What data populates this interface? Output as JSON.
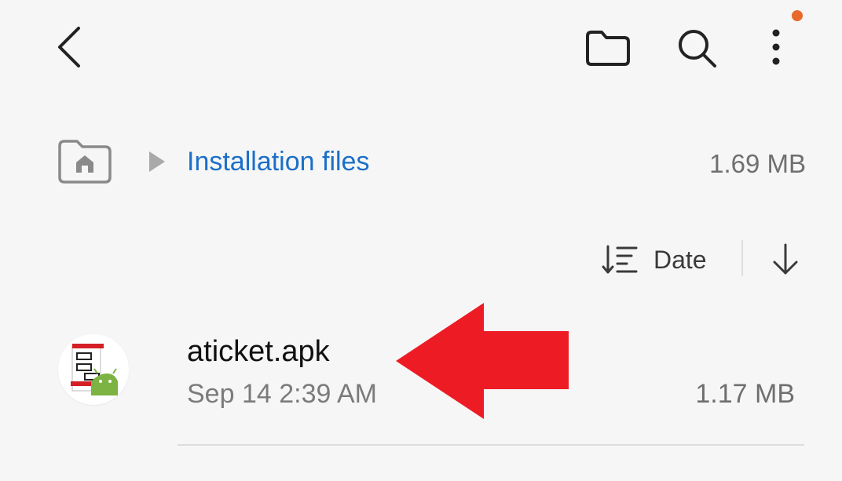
{
  "header": {
    "back_icon": "chevron-left-icon",
    "folder_icon": "folder-icon",
    "search_icon": "search-icon",
    "more_icon": "more-vertical-icon",
    "notification_dot_color": "#e8692b"
  },
  "breadcrumb": {
    "home_icon": "home-folder-icon",
    "label": "Installation files",
    "size": "1.69 MB",
    "label_color": "#1b6fc8"
  },
  "sort": {
    "icon": "sort-icon",
    "label": "Date",
    "direction_icon": "arrow-down-icon"
  },
  "files": [
    {
      "name": "aticket.apk",
      "date": "Sep 14 2:39 AM",
      "size": "1.17 MB",
      "icon": "apk-app-icon"
    }
  ],
  "annotation": {
    "arrow_color": "#ed1c24",
    "arrow_icon": "left-arrow-annotation"
  }
}
